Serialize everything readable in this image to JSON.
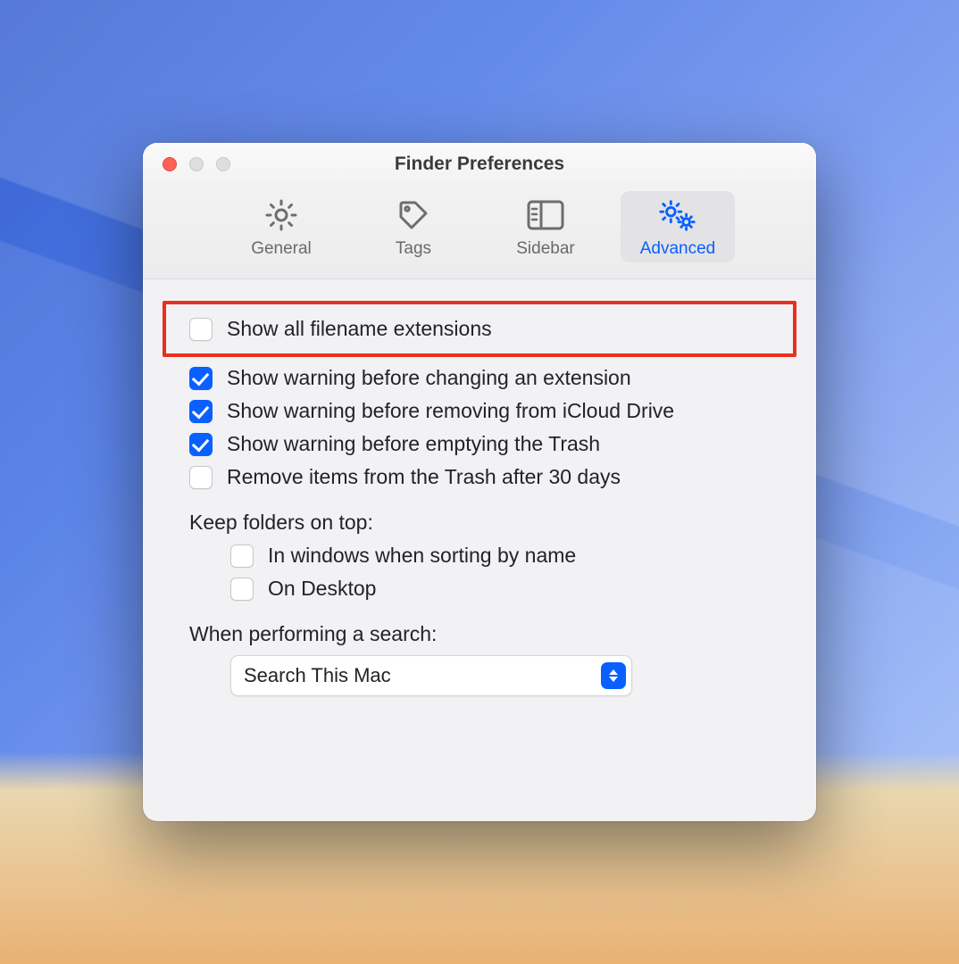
{
  "window": {
    "title": "Finder Preferences"
  },
  "tabs": {
    "general": "General",
    "tags": "Tags",
    "sidebar": "Sidebar",
    "advanced": "Advanced"
  },
  "options": {
    "show_ext": {
      "label": "Show all filename extensions",
      "checked": false,
      "highlighted": true
    },
    "warn_ext": {
      "label": "Show warning before changing an extension",
      "checked": true
    },
    "warn_icloud": {
      "label": "Show warning before removing from iCloud Drive",
      "checked": true
    },
    "warn_trash": {
      "label": "Show warning before emptying the Trash",
      "checked": true
    },
    "auto_trash": {
      "label": "Remove items from the Trash after 30 days",
      "checked": false
    }
  },
  "keep_on_top": {
    "heading": "Keep folders on top:",
    "in_windows": {
      "label": "In windows when sorting by name",
      "checked": false
    },
    "on_desktop": {
      "label": "On Desktop",
      "checked": false
    }
  },
  "search": {
    "heading": "When performing a search:",
    "selected": "Search This Mac"
  }
}
